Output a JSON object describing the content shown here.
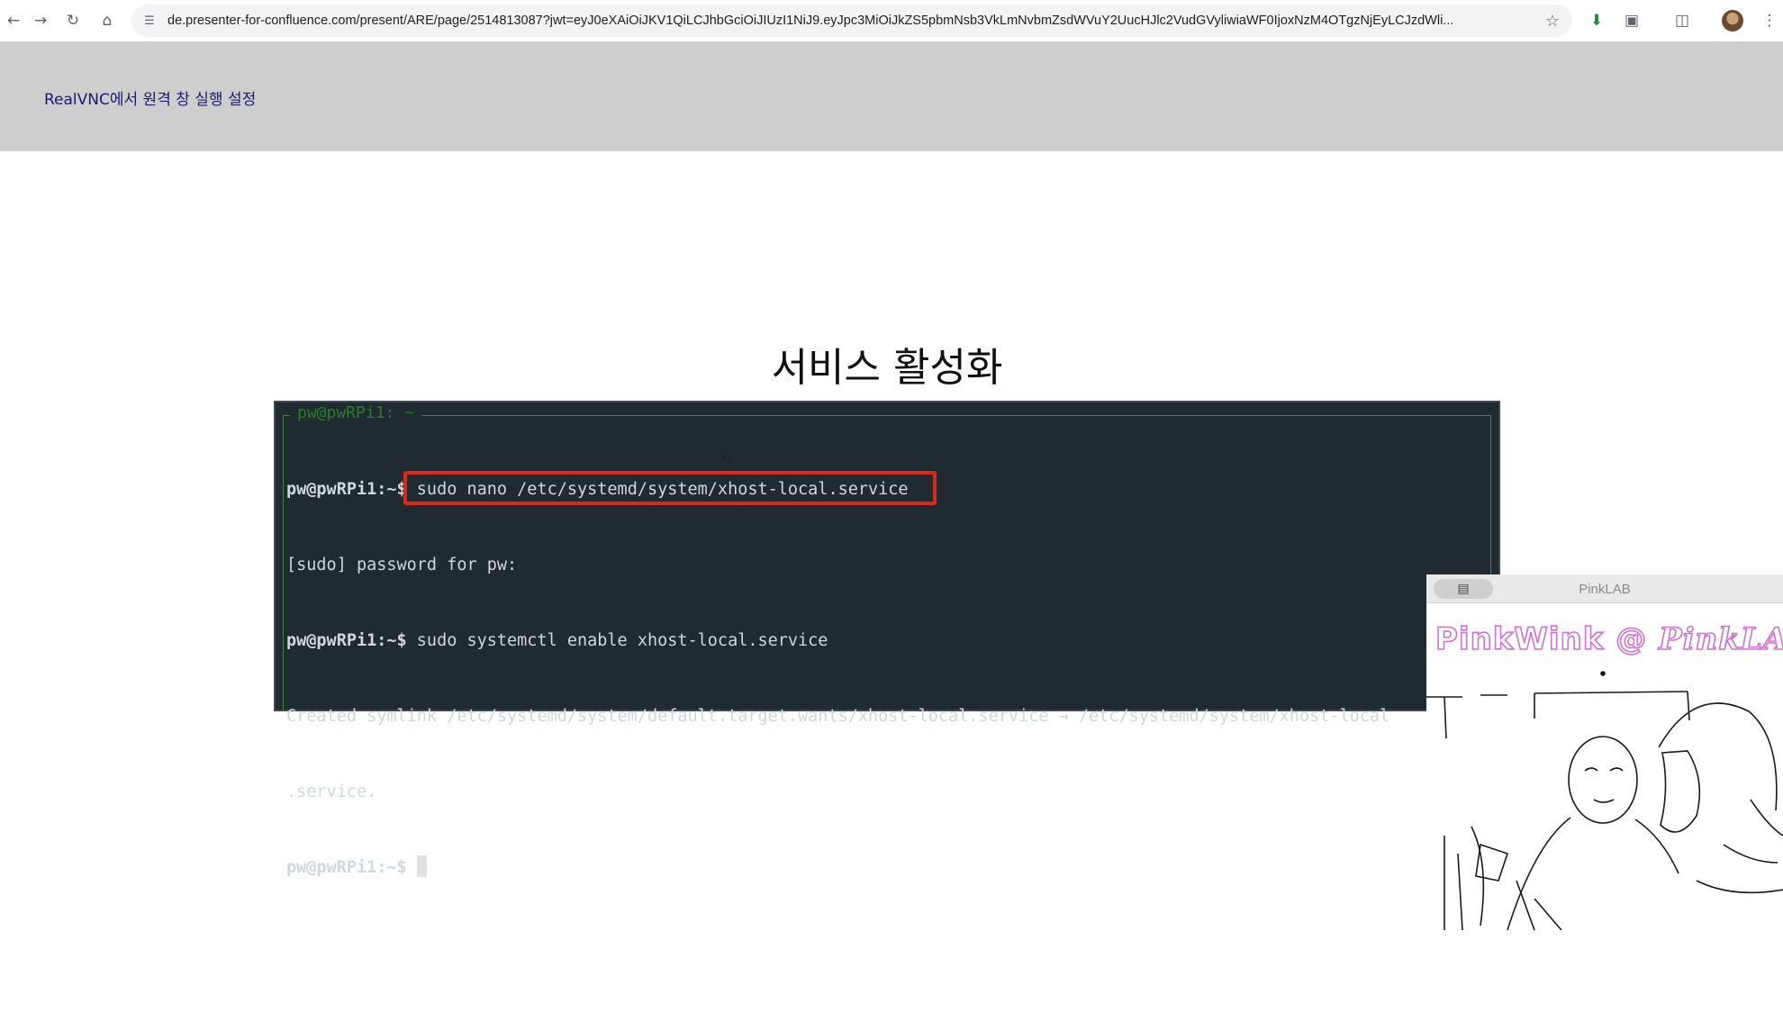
{
  "browser": {
    "url": "de.presenter-for-confluence.com/present/ARE/page/2514813087?jwt=eyJ0eXAiOiJKV1QiLCJhbGciOiJIUzI1NiJ9.eyJpc3MiOiJkZS5pbmNsb3VkLmNvbmZsdWVuY2UucHJlc2VudGVyliwiaWF0IjoxNzM4OTgzNjEyLCJzdWli..."
  },
  "header": {
    "title": "RealVNC에서 원격 창 실행 설정"
  },
  "slide": {
    "title": "서비스 활성화",
    "terminal": {
      "frame_title": "pw@pwRPi1: ~",
      "lines": [
        {
          "prompt": "pw@pwRPi1:~$",
          "text": " sudo nano /etc/systemd/system/xhost-local.service"
        },
        {
          "prompt": "",
          "text": "[sudo] password for pw:"
        },
        {
          "prompt": "pw@pwRPi1:~$",
          "text": " sudo systemctl enable xhost-local.service"
        },
        {
          "prompt": "",
          "text": "Created symlink /etc/systemd/system/default.target.wants/xhost-local.service → /etc/systemd/system/xhost-local"
        },
        {
          "prompt": "",
          "text": ".service."
        },
        {
          "prompt": "pw@pwRPi1:~$",
          "text": " "
        }
      ]
    }
  },
  "webcam": {
    "window_title": "PinkLAB",
    "banner_left": "PinkWink @",
    "banner_right": "PinkLAB"
  }
}
